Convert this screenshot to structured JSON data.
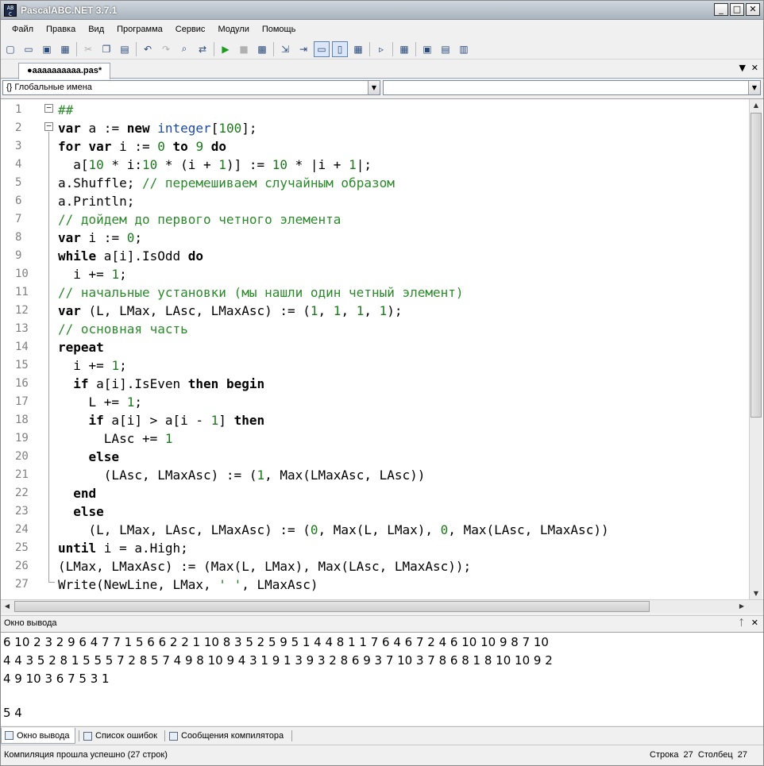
{
  "window": {
    "title": "PascalABC.NET 3.7.1",
    "min": "_",
    "max": "□",
    "close": "✕"
  },
  "menu": [
    "Файл",
    "Правка",
    "Вид",
    "Программа",
    "Сервис",
    "Модули",
    "Помощь"
  ],
  "toolbar": [
    {
      "icon": "new-file-icon",
      "glyph": "▢"
    },
    {
      "icon": "open-folder-icon",
      "glyph": "▭"
    },
    {
      "icon": "save-icon",
      "glyph": "▣"
    },
    {
      "icon": "save-all-icon",
      "glyph": "▦"
    },
    {
      "sep": true
    },
    {
      "icon": "cut-icon",
      "glyph": "✂"
    },
    {
      "icon": "copy-icon",
      "glyph": "❐"
    },
    {
      "icon": "paste-icon",
      "glyph": "▤"
    },
    {
      "sep": true
    },
    {
      "icon": "undo-icon",
      "glyph": "↶"
    },
    {
      "icon": "redo-icon",
      "glyph": "↷"
    },
    {
      "icon": "find-icon",
      "glyph": "⌕"
    },
    {
      "icon": "replace-icon",
      "glyph": "⇄"
    },
    {
      "sep": true
    },
    {
      "icon": "run-icon",
      "glyph": "▶"
    },
    {
      "icon": "stop-icon",
      "glyph": "■"
    },
    {
      "icon": "compile-icon",
      "glyph": "▩"
    },
    {
      "sep": true
    },
    {
      "icon": "step-into-icon",
      "glyph": "⇲"
    },
    {
      "icon": "step-over-icon",
      "glyph": "⇥"
    },
    {
      "icon": "output-toggle-icon",
      "glyph": "▭"
    },
    {
      "icon": "layout-toggle-icon",
      "glyph": "▯"
    },
    {
      "icon": "format-icon",
      "glyph": "▦"
    },
    {
      "sep": true
    },
    {
      "icon": "debug-icon",
      "glyph": "▹"
    },
    {
      "sep": true
    },
    {
      "icon": "watch-icon",
      "glyph": "▦"
    },
    {
      "sep": true
    },
    {
      "icon": "form-designer-icon",
      "glyph": "▣"
    },
    {
      "icon": "template-icon",
      "glyph": "▤"
    },
    {
      "icon": "reference-icon",
      "glyph": "▥"
    }
  ],
  "file_tab": {
    "label": "●aaaaaaaaaa.pas*",
    "menu_arrow": "▼",
    "close": "✕"
  },
  "scope_selector": {
    "value": "{} Глобальные имена"
  },
  "member_selector": {
    "value": ""
  },
  "code_lines": [
    [
      {
        "t": "##",
        "c": "cm"
      }
    ],
    [
      {
        "t": "var",
        "c": "kw"
      },
      {
        "t": " a := "
      },
      {
        "t": "new",
        "c": "kw"
      },
      {
        "t": " "
      },
      {
        "t": "integer",
        "c": "ty"
      },
      {
        "t": "["
      },
      {
        "t": "100",
        "c": "num"
      },
      {
        "t": "];"
      }
    ],
    [
      {
        "t": "for",
        "c": "kw"
      },
      {
        "t": " "
      },
      {
        "t": "var",
        "c": "kw"
      },
      {
        "t": " i := "
      },
      {
        "t": "0",
        "c": "num"
      },
      {
        "t": " "
      },
      {
        "t": "to",
        "c": "kw"
      },
      {
        "t": " "
      },
      {
        "t": "9",
        "c": "num"
      },
      {
        "t": " "
      },
      {
        "t": "do",
        "c": "kw"
      }
    ],
    [
      {
        "t": "  a["
      },
      {
        "t": "10",
        "c": "num"
      },
      {
        "t": " * i:"
      },
      {
        "t": "10",
        "c": "num"
      },
      {
        "t": " * (i + "
      },
      {
        "t": "1",
        "c": "num"
      },
      {
        "t": ")] := "
      },
      {
        "t": "10",
        "c": "num"
      },
      {
        "t": " * |i + "
      },
      {
        "t": "1",
        "c": "num"
      },
      {
        "t": "|;"
      }
    ],
    [
      {
        "t": "a.Shuffle; "
      },
      {
        "t": "// перемешиваем случайным образом",
        "c": "cm"
      }
    ],
    [
      {
        "t": "a.Println;"
      }
    ],
    [
      {
        "t": "// дойдем до первого четного элемента",
        "c": "cm"
      }
    ],
    [
      {
        "t": "var",
        "c": "kw"
      },
      {
        "t": " i := "
      },
      {
        "t": "0",
        "c": "num"
      },
      {
        "t": ";"
      }
    ],
    [
      {
        "t": "while",
        "c": "kw"
      },
      {
        "t": " a[i].IsOdd "
      },
      {
        "t": "do",
        "c": "kw"
      }
    ],
    [
      {
        "t": "  i += "
      },
      {
        "t": "1",
        "c": "num"
      },
      {
        "t": ";"
      }
    ],
    [
      {
        "t": "// начальные установки (мы нашли один четный элемент)",
        "c": "cm"
      }
    ],
    [
      {
        "t": "var",
        "c": "kw"
      },
      {
        "t": " (L, LMax, LAsc, LMaxAsc) := ("
      },
      {
        "t": "1",
        "c": "num"
      },
      {
        "t": ", "
      },
      {
        "t": "1",
        "c": "num"
      },
      {
        "t": ", "
      },
      {
        "t": "1",
        "c": "num"
      },
      {
        "t": ", "
      },
      {
        "t": "1",
        "c": "num"
      },
      {
        "t": ");"
      }
    ],
    [
      {
        "t": "// основная часть",
        "c": "cm"
      }
    ],
    [
      {
        "t": "repeat",
        "c": "kw"
      }
    ],
    [
      {
        "t": "  i += "
      },
      {
        "t": "1",
        "c": "num"
      },
      {
        "t": ";"
      }
    ],
    [
      {
        "t": "  "
      },
      {
        "t": "if",
        "c": "kw"
      },
      {
        "t": " a[i].IsEven "
      },
      {
        "t": "then",
        "c": "kw"
      },
      {
        "t": " "
      },
      {
        "t": "begin",
        "c": "kw"
      }
    ],
    [
      {
        "t": "    L += "
      },
      {
        "t": "1",
        "c": "num"
      },
      {
        "t": ";"
      }
    ],
    [
      {
        "t": "    "
      },
      {
        "t": "if",
        "c": "kw"
      },
      {
        "t": " a[i] > a[i - "
      },
      {
        "t": "1",
        "c": "num"
      },
      {
        "t": "] "
      },
      {
        "t": "then",
        "c": "kw"
      }
    ],
    [
      {
        "t": "      LAsc += "
      },
      {
        "t": "1",
        "c": "num"
      }
    ],
    [
      {
        "t": "    "
      },
      {
        "t": "else",
        "c": "kw"
      }
    ],
    [
      {
        "t": "      (LAsc, LMaxAsc) := ("
      },
      {
        "t": "1",
        "c": "num"
      },
      {
        "t": ", Max(LMaxAsc, LAsc))"
      }
    ],
    [
      {
        "t": "  "
      },
      {
        "t": "end",
        "c": "kw"
      }
    ],
    [
      {
        "t": "  "
      },
      {
        "t": "else",
        "c": "kw"
      }
    ],
    [
      {
        "t": "    (L, LMax, LAsc, LMaxAsc) := ("
      },
      {
        "t": "0",
        "c": "num"
      },
      {
        "t": ", Max(L, LMax), "
      },
      {
        "t": "0",
        "c": "num"
      },
      {
        "t": ", Max(LAsc, LMaxAsc))"
      }
    ],
    [
      {
        "t": "until",
        "c": "kw"
      },
      {
        "t": " i = a.High;"
      }
    ],
    [
      {
        "t": "(LMax, LMaxAsc) := (Max(L, LMax), Max(LAsc, LMaxAsc));"
      }
    ],
    [
      {
        "t": "Write(NewLine, LMax, "
      },
      {
        "t": "' '",
        "c": "str"
      },
      {
        "t": ", LMaxAsc)"
      }
    ]
  ],
  "output_panel": {
    "title": "Окно вывода",
    "pin": "ᛏ",
    "close": "✕",
    "lines": [
      "6 10 2 3 2 9 6 4 7 7 1 5 6 6 2 2 1 10 8 3 5 2 5 9 5 1 4 4 8 1 1 7 6 4 6 7 2 4 6 10 10 9 8 7 10",
      "4 4 3 5 2 8 1 5 5 5 7 2 8 5 7 4 9 8 10 9 4 3 1 9 1 3 9 3 2 8 6 9 3 7 10 3 7 8 6 8 1 8 10 10 9 2",
      "4 9 10 3 6 7 5 3 1",
      "",
      "5 4"
    ]
  },
  "bottom_tabs": [
    "Окно вывода",
    "Список ошибок",
    "Сообщения компилятора"
  ],
  "status": {
    "message": "Компиляция прошла успешно (27 строк)",
    "position": "Строка  27  Столбец  27"
  }
}
